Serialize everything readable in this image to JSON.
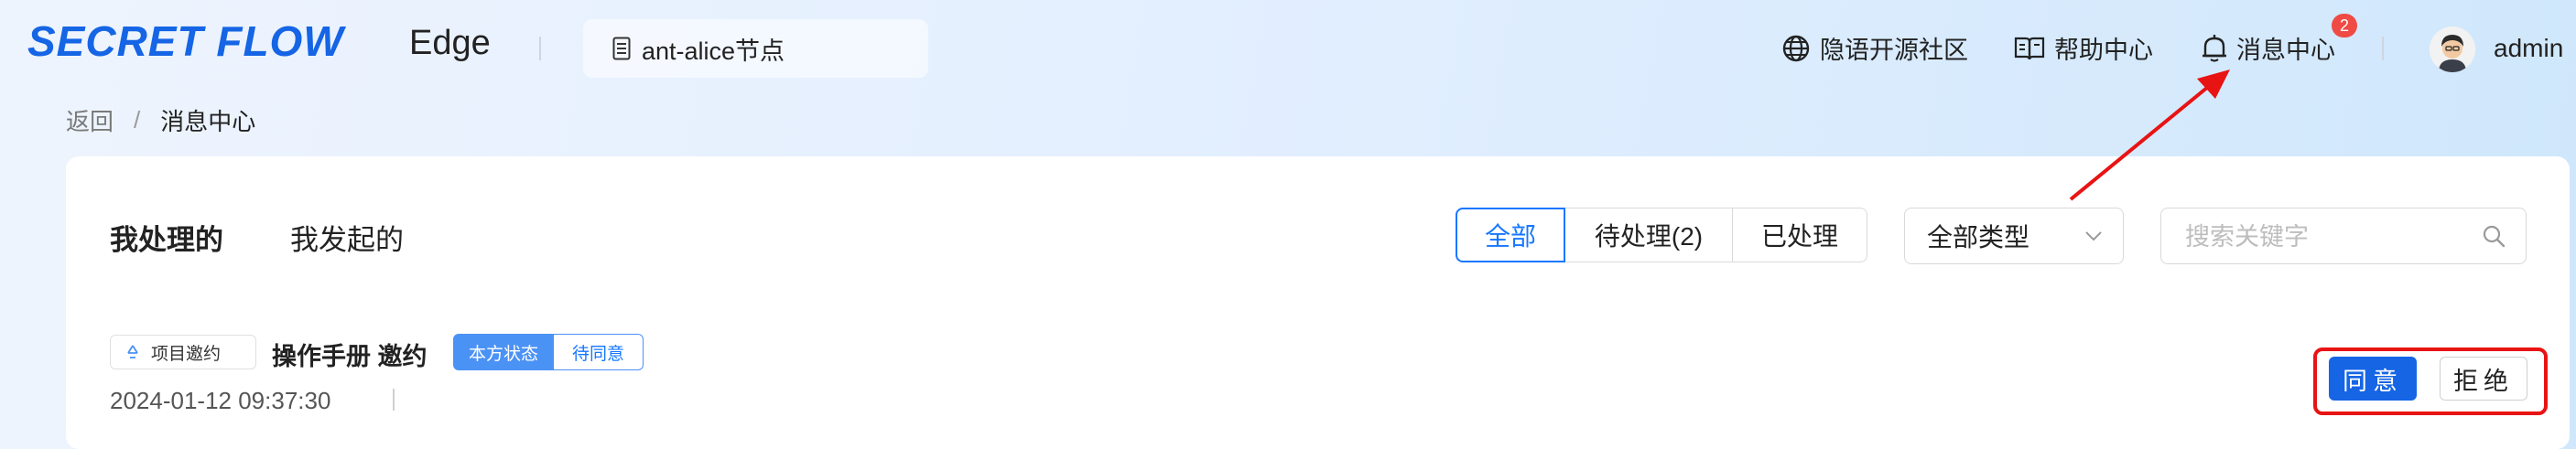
{
  "header": {
    "logo_text": "SECRET FLOW",
    "product": "Edge",
    "node_name": "ant-alice节点",
    "nav": {
      "community": "隐语开源社区",
      "help": "帮助中心",
      "messages": "消息中心",
      "message_badge": "2"
    },
    "username": "admin"
  },
  "breadcrumb": {
    "back": "返回",
    "separator": "/",
    "current": "消息中心"
  },
  "tabs": [
    {
      "label": "我处理的",
      "active": true
    },
    {
      "label": "我发起的",
      "active": false
    }
  ],
  "filters": {
    "segments": [
      {
        "label": "全部",
        "selected": true
      },
      {
        "label": "待处理(2)",
        "selected": false
      },
      {
        "label": "已处理",
        "selected": false
      }
    ],
    "type_select": "全部类型",
    "search_placeholder": "搜索关键字"
  },
  "messages": [
    {
      "type_tag": "项目邀约",
      "title": "操作手册  邀约",
      "status_key": "本方状态",
      "status_value": "待同意",
      "time": "2024-01-12 09:37:30",
      "actions": {
        "agree": "同意",
        "reject": "拒绝"
      }
    }
  ],
  "annotations": {
    "highlight_color": "#e81313"
  },
  "colors": {
    "accent": "#1677ff",
    "primary_button": "#1565e5",
    "badge": "#f04a45"
  }
}
